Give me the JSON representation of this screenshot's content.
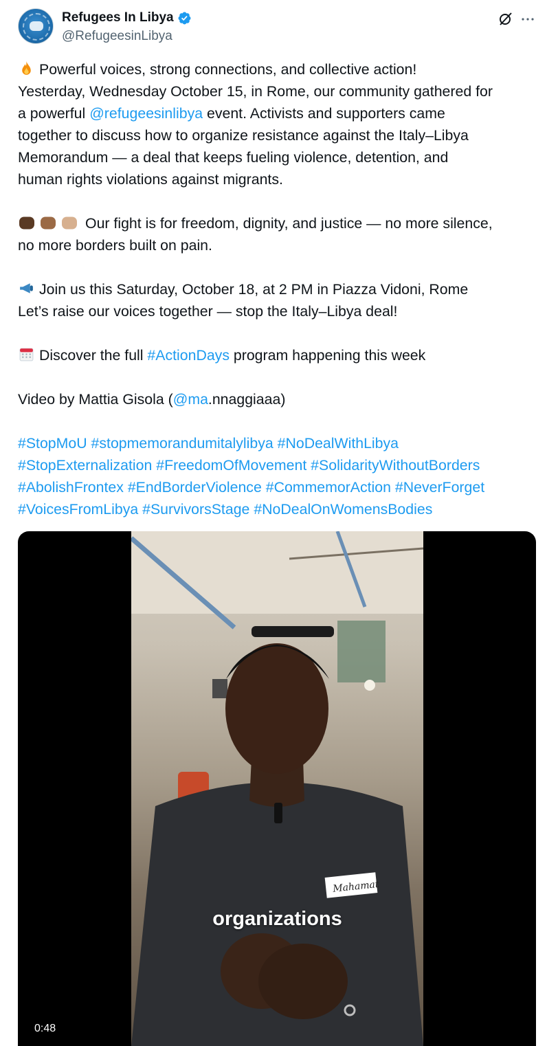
{
  "author": {
    "display_name": "Refugees In Libya",
    "handle": "@RefugeesinLibya",
    "avatar_icon": "refugees-in-libya-logo-icon",
    "verified_icon": "verified-badge-icon"
  },
  "actions": {
    "grok_icon": "grok-icon",
    "more_icon": "more-options-icon"
  },
  "colors": {
    "link": "#1d9bf0",
    "text": "#0f1419",
    "secondary": "#536471",
    "verified": "#1d9bf0"
  },
  "text": {
    "l1": "Powerful voices, strong connections, and collective action!",
    "l2": "Yesterday, Wednesday October 15, in Rome, our community gathered for",
    "l3_a": "a powerful ",
    "l3_mention": "@refugeesinlibya",
    "l3_b": " event. Activists and supporters came",
    "l4": "together to discuss how to organize resistance against the Italy–Libya",
    "l5": "Memorandum — a deal that keeps fueling violence, detention, and",
    "l6": "human rights violations against migrants.",
    "l7": "Our fight is for freedom, dignity, and justice — no more silence,",
    "l8": "no more borders built on pain.",
    "l9": "Join us this Saturday, October 18, at 2 PM in Piazza Vidoni, Rome",
    "l10": "Let’s raise our voices together — stop the Italy–Libya deal!",
    "l11_a": "Discover the full ",
    "l11_tag": "#ActionDays",
    "l11_b": " program happening this week",
    "l12_a": "Video by Mattia Gisola (",
    "l12_mention": "@ma",
    "l12_b": ".nnaggiaaa)",
    "emojis": [
      "fire-emoji-icon",
      "raised-fists-emoji-icon",
      "megaphone-emoji-icon",
      "calendar-emoji-icon"
    ]
  },
  "hashtags": {
    "row1": [
      "#StopMoU",
      "#stopmemorandumitalylibya",
      "#NoDealWithLibya"
    ],
    "row2": [
      "#StopExternalization",
      "#FreedomOfMovement",
      "#SolidarityWithoutBorders"
    ],
    "row3": [
      "#AbolishFrontex",
      "#EndBorderViolence",
      "#CommemorAction",
      "#NeverForget"
    ],
    "row4": [
      "#VoicesFromLibya",
      "#SurvivorsStage",
      "#NoDealOnWomensBodies"
    ]
  },
  "video": {
    "caption": "organizations",
    "duration": "0:48",
    "name_tag": "Mahamat"
  }
}
